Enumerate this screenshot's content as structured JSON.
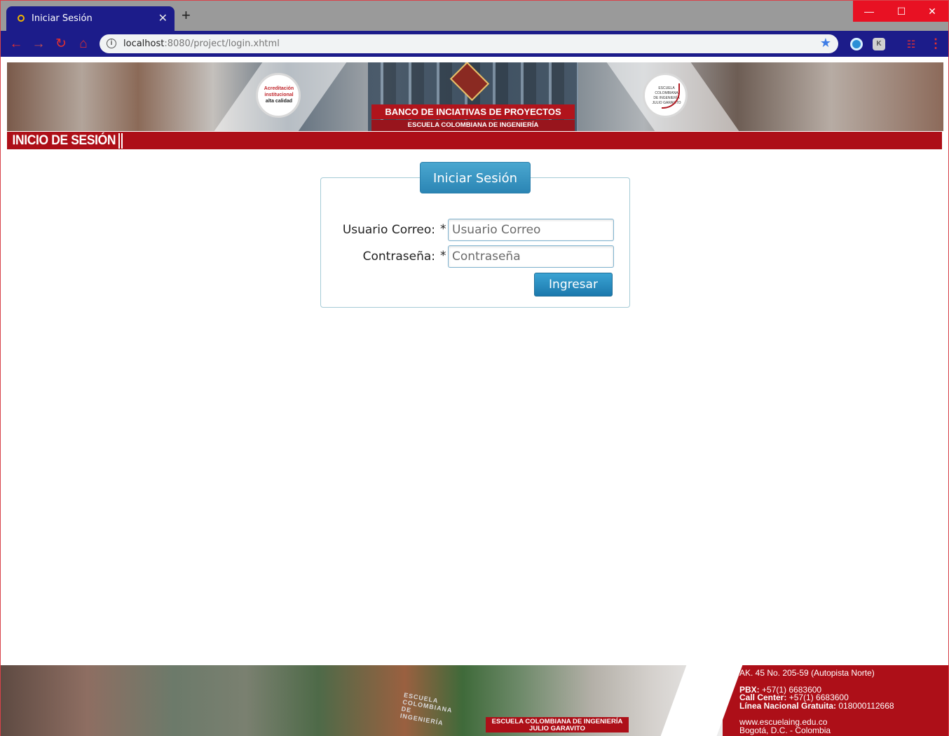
{
  "browser": {
    "tab_title": "Iniciar Sesión",
    "tab_close": "✕",
    "new_tab": "+",
    "url_host": "localhost",
    "url_rest": ":8080/project/login.xhtml",
    "window_controls": [
      "—",
      "☐",
      "✕"
    ]
  },
  "banner": {
    "title": "BANCO DE INCIATIVAS DE PROYECTOS",
    "subtitle": "ESCUELA COLOMBIANA DE INGENIERÍA",
    "badge_left_lines": [
      "Acreditación",
      "institucional",
      "alta calidad"
    ],
    "badge_right_lines": [
      "ESCUELA",
      "COLOMBIANA",
      "DE INGENIERÍA",
      "JULIO GARAVITO"
    ]
  },
  "section_title": "INICIO DE SESIÓN",
  "login": {
    "legend": "Iniciar Sesión",
    "user_label": "Usuario Correo:",
    "user_placeholder": "Usuario Correo",
    "user_value": "",
    "pass_label": "Contraseña:",
    "pass_placeholder": "Contraseña",
    "pass_value": "",
    "required_mark": "*",
    "submit_label": "Ingresar"
  },
  "footer": {
    "address": "AK. 45 No. 205-59 (Autopista Norte)",
    "pbx_label": "PBX:",
    "pbx": "+57(1) 6683600",
    "callcenter_label": "Call Center:",
    "callcenter": "+57(1) 6683600",
    "linea_label": "Línea Nacional Gratuita:",
    "linea": "018000112668",
    "web": "www.escuelaing.edu.co",
    "city": "Bogotá, D.C. - Colombia",
    "brand_line1": "ESCUELA COLOMBIANA DE INGENIERÍA",
    "brand_line2": "JULIO GARAVITO",
    "engraving": "ESCUELA COLOMBIANA DE INGENIERÍA"
  },
  "colors": {
    "brand_red": "#ad0f18",
    "browser_blue": "#1c1c8a",
    "button_blue": "#2b85b4"
  }
}
